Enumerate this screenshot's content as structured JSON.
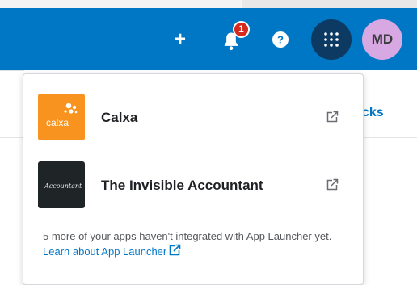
{
  "header": {
    "create_symbol": "+",
    "notifications": {
      "count": "1",
      "icon": "bell-icon"
    },
    "help_icon": "help-circle-icon",
    "app_launcher_icon": "grid-dots-icon",
    "user_initials": "MD"
  },
  "page": {
    "partial_link_text": "cks"
  },
  "app_launcher": {
    "apps": [
      {
        "name": "Calxa",
        "logo_text": "calxa",
        "logo_color": "#f7931e",
        "link_icon": "external-link-icon"
      },
      {
        "name": "The Invisible Accountant",
        "logo_text": "Accountant",
        "logo_color": "#1f2527",
        "link_icon": "external-link-icon"
      }
    ],
    "footer": {
      "text": "5 more of your apps haven't integrated with App Launcher yet.",
      "link_text": "Learn about App Launcher"
    }
  },
  "colors": {
    "brand_blue": "#0077c5",
    "launcher_active": "#0d3a63",
    "avatar_bg": "#d8a8e2",
    "badge_red": "#d52b1e"
  }
}
